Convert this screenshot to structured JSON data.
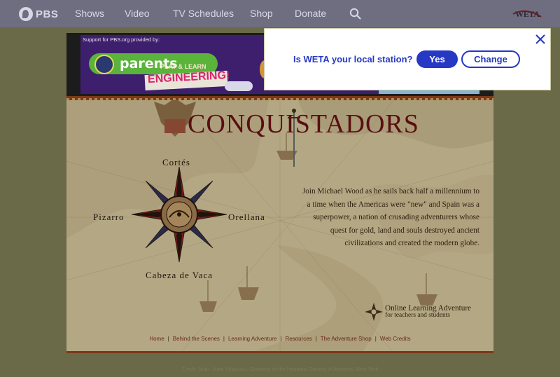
{
  "nav": {
    "logo_text": "PBS",
    "links": [
      "Shows",
      "Video",
      "TV Schedules",
      "Shop",
      "Donate"
    ],
    "search_icon": "search-icon",
    "station_logo_text": "WETA"
  },
  "ad": {
    "label": "Support for PBS.org provided by:",
    "kid_logo": "pbs-kids-logo",
    "headline": "parents",
    "tagline": "PLAY & LEARN",
    "subject": "ENGINEERING!"
  },
  "site": {
    "title": "CONQUISTADORS",
    "compass": {
      "north": "Cortés",
      "west": "Pizarro",
      "east": "Orellana",
      "south": "Cabeza de Vaca"
    },
    "blurb": "Join Michael Wood as he sails back half a millennium to a time when the Americas were \"new\" and Spain was a superpower, a nation of crusading adventurers whose quest for gold, land and souls destroyed ancient civilizations and created the modern globe.",
    "ola": {
      "line1": "Online Learning Adventure",
      "line2": "for teachers and students"
    },
    "footer_links": [
      "Home",
      "Behind the Scenes",
      "Learning Adventure",
      "Resources",
      "The Adventure Shop",
      "Web Credits"
    ],
    "credits": "Credit: Map: Juan Vespucci, Courtesy of the Hispanic Society of America, New York"
  },
  "modal": {
    "question": "Is WETA your local station?",
    "yes_label": "Yes",
    "change_label": "Change",
    "close_icon": "close-icon"
  }
}
